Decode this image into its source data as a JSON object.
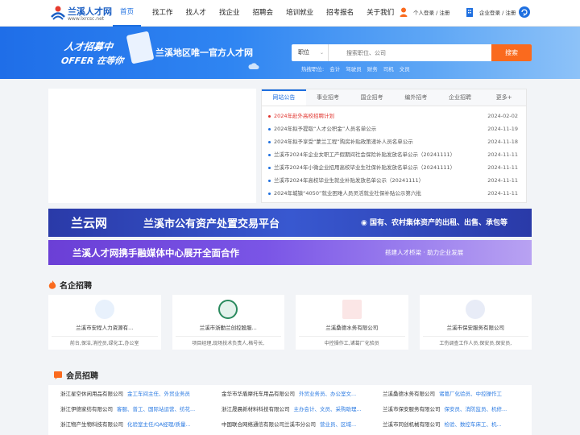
{
  "header": {
    "logo_name": "兰溪人才网",
    "logo_url": "www.lxrcsc.net",
    "nav": [
      "首页",
      "找工作",
      "找人才",
      "找企业",
      "招聘会",
      "培训就业",
      "招考报名",
      "关于我们"
    ],
    "personal_login": "个人登录 / 注册",
    "company_login": "企业登录 / 注册",
    "colors": {
      "brand": "#1b5fc4",
      "accent": "#1e6fe0",
      "orange": "#fa6a1e"
    }
  },
  "banner": {
    "promo_line1": "人才招募中",
    "promo_line2": "OFFER 在等你",
    "slogan": "兰溪地区唯一官方人才网",
    "search_type": "职位",
    "search_placeholder": "搜索职位、公司",
    "search_button": "搜索",
    "hot_label": "热搜职位:",
    "hot_items": [
      "会计",
      "驾驶员",
      "财务",
      "司机",
      "文员"
    ]
  },
  "news": {
    "tabs": [
      "网站公告",
      "事业招考",
      "国企招考",
      "编外招考",
      "企业招聘",
      "更多+"
    ],
    "items": [
      {
        "title": "2024年赴外高校招聘计划",
        "date": "2024-02-02"
      },
      {
        "title": "2024年拟予提取“人才公积金”人员名单公示",
        "date": "2024-11-19"
      },
      {
        "title": "2024年拟予享受“蒙兰工程”购房补贴政策递补人员名单公示",
        "date": "2024-11-18"
      },
      {
        "title": "兰溪市2024年企业女职工产假期间社会保险补贴发放名单公示（20241111）",
        "date": "2024-11-11"
      },
      {
        "title": "兰溪市2024年小微企业招用高校毕业生社保补贴发放名单公示（20241111）",
        "date": "2024-11-11"
      },
      {
        "title": "兰溪市2024年高校毕业生就业补贴发放名单公示（20241111）",
        "date": "2024-11-11"
      },
      {
        "title": "2024年城镇“4050”就业困难人员灵活就业社保补贴公示第六批",
        "date": "2024-11-11"
      }
    ]
  },
  "ads": {
    "ad1_logo": "兰云网",
    "ad1_title": "兰溪市公有资产处置交易平台",
    "ad1_sub": "◉ 国有、农村集体资产的出租、出售、承包等",
    "ad2_title": "兰溪人才网携手融媒体中心展开全面合作",
    "ad2_sub": "搭建人才桥梁 · 助力企业发展"
  },
  "famous": {
    "title": "名企招聘",
    "cards": [
      {
        "name": "兰溪市安程人力资源有...",
        "jobs": "前台,保洁,消控员,绿化工,办公室"
      },
      {
        "name": "兰溪市浙勤兰创控股服...",
        "jobs": "项目经理,现场技术负责人,格号长,"
      },
      {
        "name": "兰溪桑德水务有限公司",
        "jobs": "中控操作工,诸葛厂化验员"
      },
      {
        "name": "兰溪市保安服务有限公司",
        "jobs": "工伤调查工作人员,保安员,保安员,"
      }
    ]
  },
  "member": {
    "title": "会员招聘",
    "rows": [
      [
        {
          "company": "浙江星空休闲用品有限公司",
          "jobs": "金工车间主任、外贸业务员"
        },
        {
          "company": "金华市华盾摩托车用品有限公司",
          "jobs": "外贸业务员、办公室文..."
        },
        {
          "company": "兰溪桑德水务有限公司",
          "jobs": "诸葛厂化验员、中控操作工"
        }
      ],
      [
        {
          "company": "浙江伊德家纺有限公司",
          "jobs": "客服、普工、国际站运营、纺花..."
        },
        {
          "company": "浙江晟晨新材料科技有限公司",
          "jobs": "主办会计、文员、采购助理..."
        },
        {
          "company": "兰溪市保安服务有限公司",
          "jobs": "保安员、消防监员、机修..."
        }
      ],
      [
        {
          "company": "浙江物产生物科技有限公司",
          "jobs": "化验室主任/QA经理/质量..."
        },
        {
          "company": "中国联合网络通信有限公司兰溪市分公司",
          "jobs": "营业员、区域..."
        },
        {
          "company": "兰溪市同创机械有限公司",
          "jobs": "检验、数控车床工、机..."
        }
      ]
    ]
  }
}
